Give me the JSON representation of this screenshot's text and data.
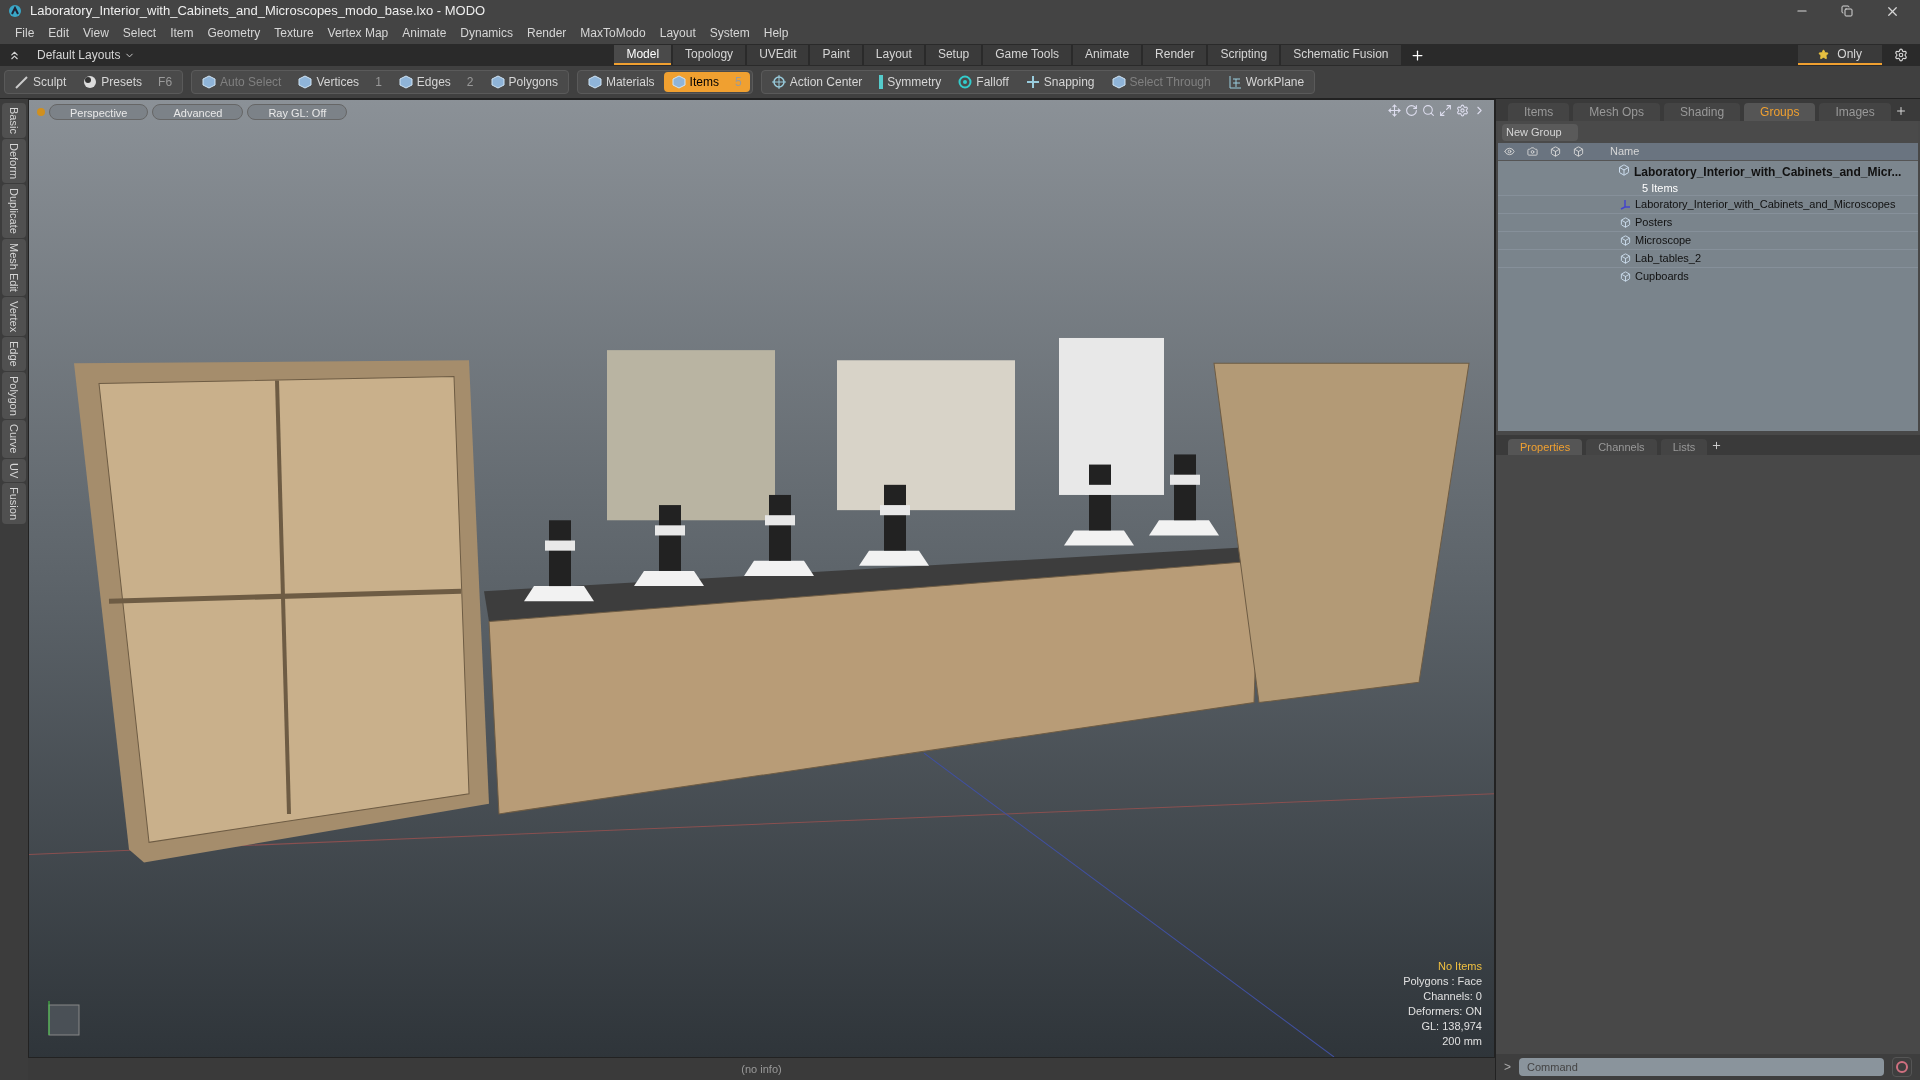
{
  "window": {
    "title": "Laboratory_Interior_with_Cabinets_and_Microscopes_modo_base.lxo - MODO"
  },
  "menu": [
    "File",
    "Edit",
    "View",
    "Select",
    "Item",
    "Geometry",
    "Texture",
    "Vertex Map",
    "Animate",
    "Dynamics",
    "Render",
    "MaxToModo",
    "Layout",
    "System",
    "Help"
  ],
  "layout_selector": "Default Layouts",
  "layout_tabs": [
    {
      "label": "Model",
      "selected": true
    },
    {
      "label": "Topology",
      "selected": false
    },
    {
      "label": "UVEdit",
      "selected": false
    },
    {
      "label": "Paint",
      "selected": false
    },
    {
      "label": "Layout",
      "selected": false
    },
    {
      "label": "Setup",
      "selected": false
    },
    {
      "label": "Game Tools",
      "selected": false
    },
    {
      "label": "Animate",
      "selected": false
    },
    {
      "label": "Render",
      "selected": false
    },
    {
      "label": "Scripting",
      "selected": false
    },
    {
      "label": "Schematic Fusion",
      "selected": false
    }
  ],
  "only_button": "Only",
  "toolbar": [
    {
      "label": "Sculpt",
      "kind": "brush",
      "selected": false,
      "disabled": false
    },
    {
      "label": "Presets",
      "shortcut": "F6",
      "kind": "sphere",
      "selected": false,
      "disabled": false
    },
    {
      "label": "Auto Select",
      "kind": "cube",
      "selected": false,
      "disabled": true
    },
    {
      "label": "Vertices",
      "shortcut": "1",
      "kind": "cube",
      "selected": false,
      "disabled": false
    },
    {
      "label": "Edges",
      "shortcut": "2",
      "kind": "cube",
      "selected": false,
      "disabled": false
    },
    {
      "label": "Polygons",
      "kind": "cube",
      "selected": false,
      "disabled": false
    },
    {
      "label": "Materials",
      "kind": "cube",
      "selected": false,
      "disabled": false
    },
    {
      "label": "Items",
      "shortcut": "5",
      "kind": "cube",
      "selected": true,
      "disabled": false
    },
    {
      "label": "Action Center",
      "kind": "target",
      "selected": false,
      "disabled": false
    },
    {
      "label": "Symmetry",
      "kind": "bar",
      "selected": false,
      "disabled": false
    },
    {
      "label": "Falloff",
      "kind": "ring",
      "selected": false,
      "disabled": false
    },
    {
      "label": "Snapping",
      "kind": "cross",
      "selected": false,
      "disabled": false
    },
    {
      "label": "Select Through",
      "kind": "cube",
      "selected": false,
      "disabled": true
    },
    {
      "label": "WorkPlane",
      "kind": "grid",
      "selected": false,
      "disabled": false
    }
  ],
  "side_tabs": [
    "Basic",
    "Deform",
    "Duplicate",
    "Mesh Edit",
    "Vertex",
    "Edge",
    "Polygon",
    "Curve",
    "UV",
    "Fusion"
  ],
  "viewport": {
    "buttons": [
      "Perspective",
      "Advanced",
      "Ray GL: Off"
    ],
    "info": [
      {
        "text": "No Items",
        "kind": "highlight"
      },
      {
        "text": "Polygons : Face",
        "kind": "normal"
      },
      {
        "text": "Channels: 0",
        "kind": "normal"
      },
      {
        "text": "Deformers: ON",
        "kind": "normal"
      },
      {
        "text": "GL: 138,974",
        "kind": "normal"
      },
      {
        "text": "200 mm",
        "kind": "normal"
      }
    ]
  },
  "panel_tabs": [
    {
      "label": "Items",
      "selected": false
    },
    {
      "label": "Mesh Ops",
      "selected": false
    },
    {
      "label": "Shading",
      "selected": false
    },
    {
      "label": "Groups",
      "selected": true
    },
    {
      "label": "Images",
      "selected": false
    }
  ],
  "new_group_button": "New Group",
  "list_header": "Name",
  "group": {
    "name": "Laboratory_Interior_with_Cabinets_and_Micr...",
    "count": "5 Items",
    "children": [
      {
        "name": "Laboratory_Interior_with_Cabinets_and_Microscopes",
        "kind": "locator"
      },
      {
        "name": "Posters",
        "kind": "mesh"
      },
      {
        "name": "Microscope",
        "kind": "mesh"
      },
      {
        "name": "Lab_tables_2",
        "kind": "mesh"
      },
      {
        "name": "Cupboards",
        "kind": "mesh"
      }
    ]
  },
  "properties_tabs": [
    {
      "label": "Properties",
      "selected": true
    },
    {
      "label": "Channels",
      "selected": false
    },
    {
      "label": "Lists",
      "selected": false
    }
  ],
  "status": "(no info)",
  "command": {
    "prompt": ">",
    "placeholder": "Command"
  }
}
